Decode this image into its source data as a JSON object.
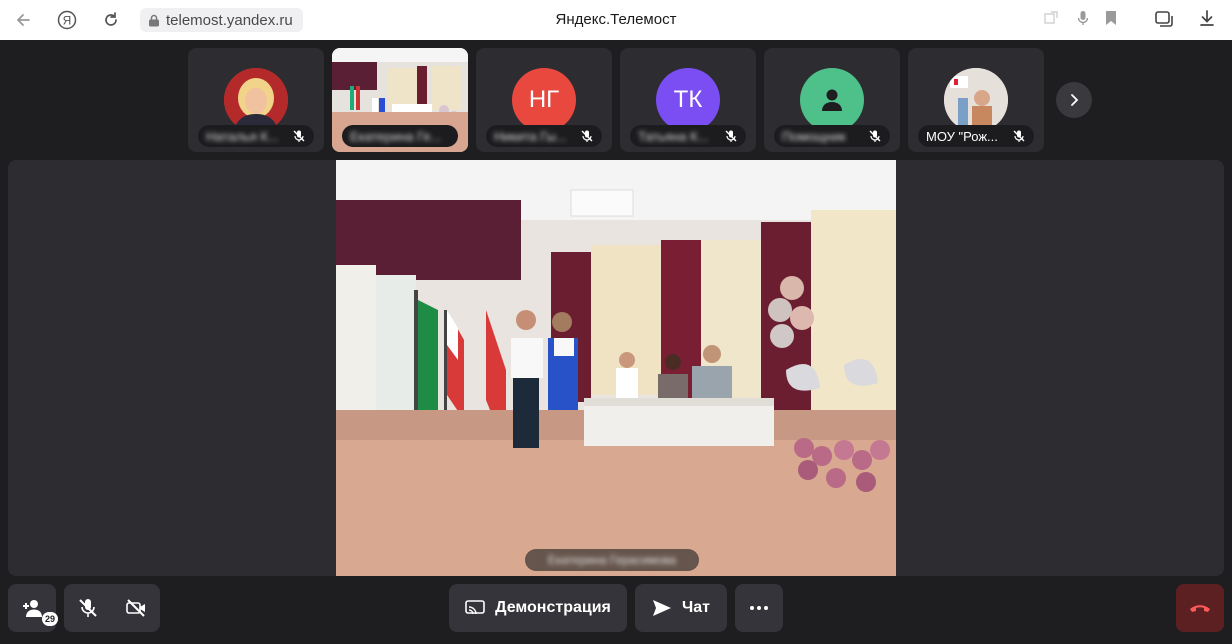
{
  "browser": {
    "url": "telemost.yandex.ru",
    "title": "Яндекс.Телемост",
    "brand_glyph": "Я"
  },
  "participants": [
    {
      "name": "Наталья К...",
      "blurred": true,
      "muted": true
    },
    {
      "name": "Екатерина Ге...",
      "blurred": true,
      "muted": false,
      "active": true
    },
    {
      "name": "Никита Гы...",
      "blurred": true,
      "muted": true,
      "initials": "НГ",
      "color": "#e8483e"
    },
    {
      "name": "Татьяна К...",
      "blurred": true,
      "muted": true,
      "initials": "ТК",
      "color": "#7b4ef3"
    },
    {
      "name": "Помощник",
      "blurred": true,
      "muted": true,
      "color": "#4ec08a"
    },
    {
      "name": "МОУ \"Рож...",
      "blurred": false,
      "muted": true
    }
  ],
  "stage": {
    "speaker_name": "Екатерина Герасимова"
  },
  "controls": {
    "participants_count": "29",
    "demo_label": "Демонстрация",
    "chat_label": "Чат"
  },
  "colors": {
    "end_call": "#5c1f22",
    "end_icon": "#ff5a5a"
  }
}
